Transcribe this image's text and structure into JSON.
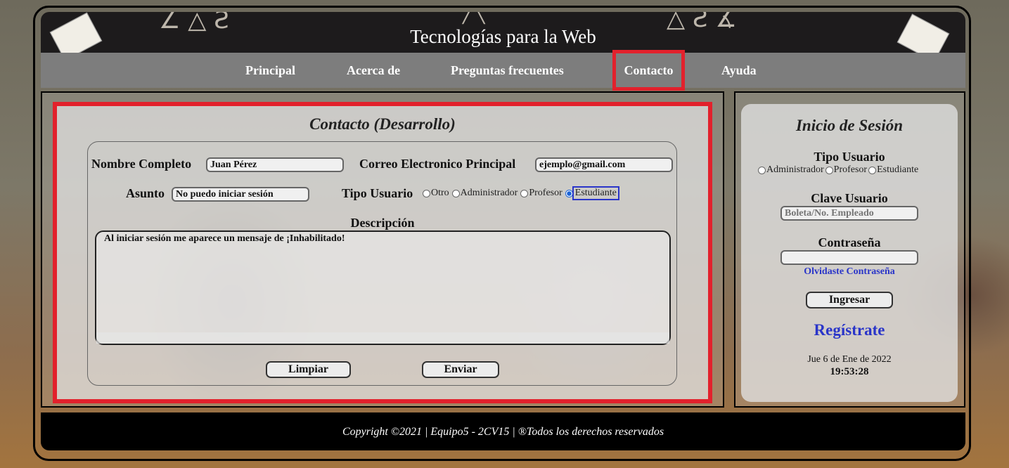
{
  "header": {
    "title": "Tecnologías para la Web"
  },
  "nav": {
    "items": [
      {
        "label": "Principal"
      },
      {
        "label": "Acerca de"
      },
      {
        "label": "Preguntas frecuentes"
      },
      {
        "label": "Contacto",
        "active": true
      },
      {
        "label": "Ayuda"
      }
    ]
  },
  "contact": {
    "title": "Contacto (Desarrollo)",
    "name_label": "Nombre Completo",
    "name_value": "Juan Pérez",
    "email_label": "Correo Electronico Principal",
    "email_value": "ejemplo@gmail.com",
    "subject_label": "Asunto",
    "subject_value": "No puedo iniciar sesión",
    "user_type_label": "Tipo Usuario",
    "user_type_options": [
      "Otro",
      "Administrador",
      "Profesor",
      "Estudiante"
    ],
    "user_type_selected": "Estudiante",
    "description_label": "Descripción",
    "description_value": "Al iniciar sesión me aparece un mensaje de ¡Inhabilitado!",
    "clear_button": "Limpiar",
    "send_button": "Enviar"
  },
  "login": {
    "title": "Inicio de Sesión",
    "user_type_label": "Tipo Usuario",
    "user_type_options": [
      "Administrador",
      "Profesor",
      "Estudiante"
    ],
    "key_label": "Clave Usuario",
    "key_placeholder": "Boleta/No. Empleado",
    "password_label": "Contraseña",
    "forgot_link": "Olvidaste Contraseña",
    "submit_button": "Ingresar",
    "register_link": "Regístrate",
    "date": "Jue 6 de Ene de 2022",
    "time": "19:53:28"
  },
  "footer": {
    "text": "Copyright ©2021 | Equipo5 - 2CV15 | ®Todos los derechos reservados"
  },
  "colors": {
    "highlight": "#e2212c",
    "link": "#2a35c9",
    "nav_bg": "#7d7d7d"
  }
}
